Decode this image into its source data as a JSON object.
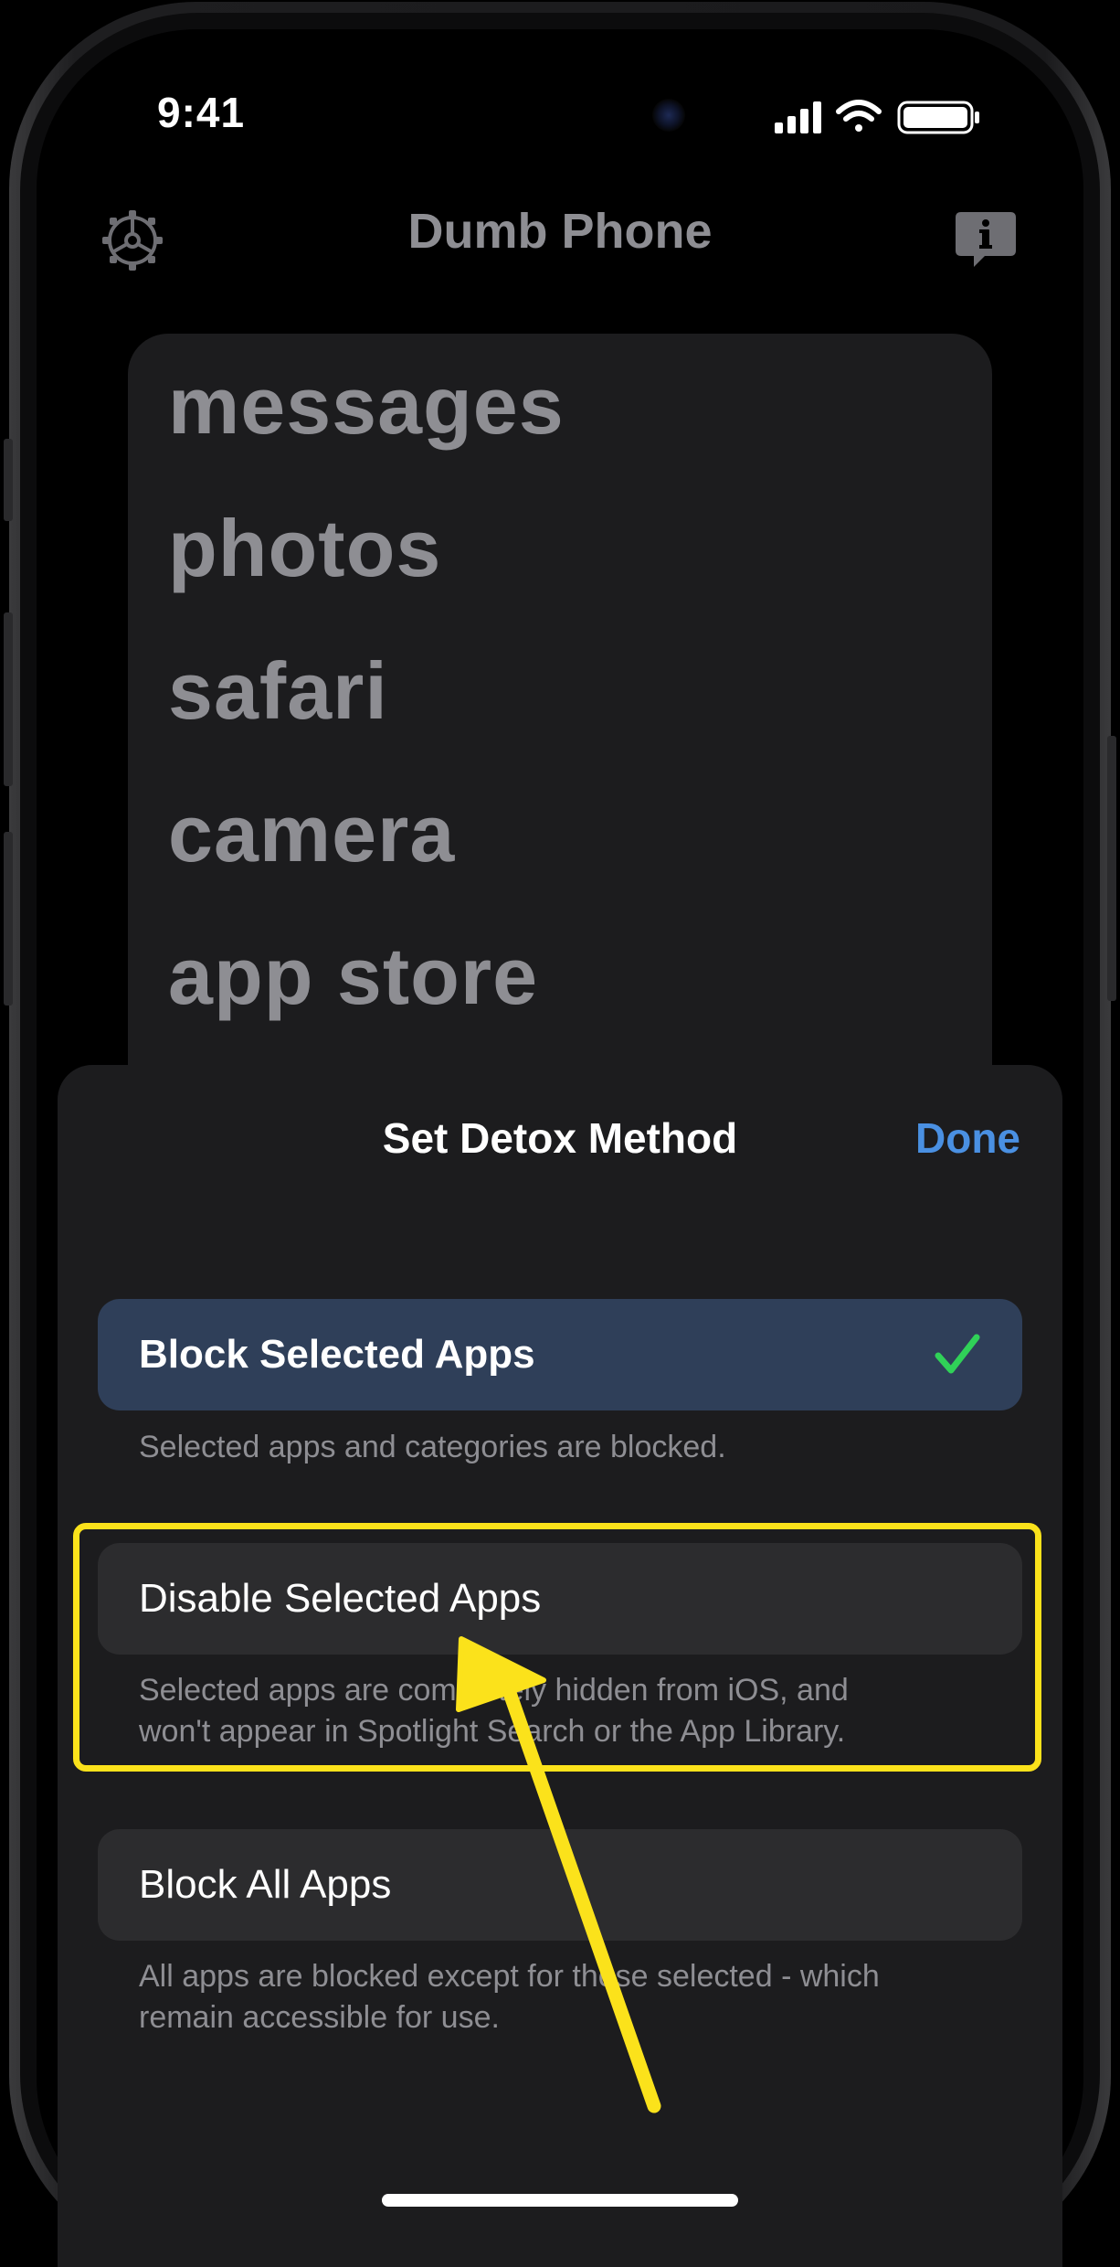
{
  "status_bar": {
    "time": "9:41"
  },
  "header": {
    "title": "Dumb Phone",
    "settings_icon": "gear-icon",
    "info_icon": "info-bubble-icon"
  },
  "app_list": {
    "items": [
      "messages",
      "photos",
      "safari",
      "camera",
      "app store"
    ]
  },
  "sheet": {
    "title": "Set Detox Method",
    "done_label": "Done",
    "options": [
      {
        "label": "Block Selected Apps",
        "description": "Selected apps and categories are blocked.",
        "selected": true
      },
      {
        "label": "Disable Selected Apps",
        "description_line1": "Selected apps are completely hidden from iOS, and",
        "description_line2": "won't appear in Spotlight Search or the App Library.",
        "selected": false
      },
      {
        "label": "Block All Apps",
        "description_line1": "All apps are blocked except for those selected - which",
        "description_line2": "remain accessible for use.",
        "selected": false
      }
    ]
  },
  "colors": {
    "accent": "#4a90e2",
    "check": "#30d158",
    "highlight": "#fbe21b",
    "selected_bg": "#2f3f59"
  }
}
